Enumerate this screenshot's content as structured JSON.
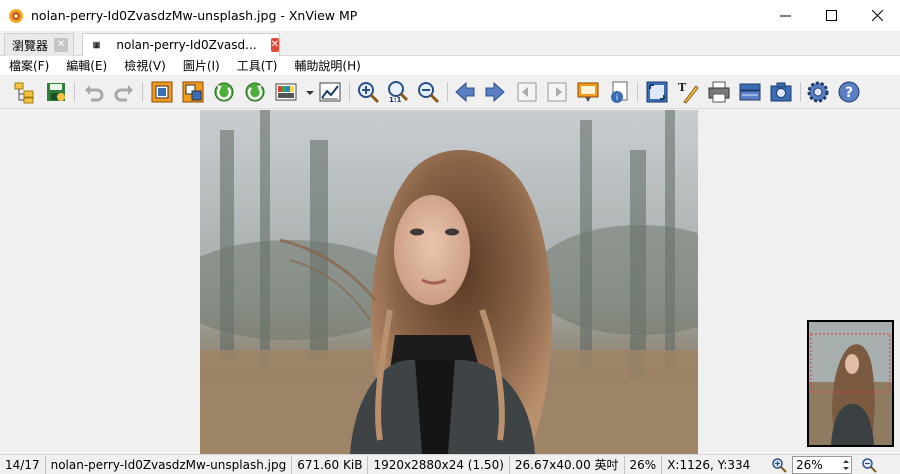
{
  "window": {
    "title": "nolan-perry-Id0ZvasdzMw-unsplash.jpg - XnView MP",
    "controls": {
      "minimize": "—",
      "maximize": "☐",
      "close": "✕"
    }
  },
  "tabs": [
    {
      "label": "瀏覽器",
      "close": "✕"
    },
    {
      "label": "nolan-perry-Id0Zvasd...",
      "close": "✕"
    }
  ],
  "menu": [
    {
      "label": "檔案(F)"
    },
    {
      "label": "編輯(E)"
    },
    {
      "label": "檢視(V)"
    },
    {
      "label": "圖片(I)"
    },
    {
      "label": "工具(T)"
    },
    {
      "label": "輔助說明(H)"
    }
  ],
  "toolbar": {
    "zoom_1to1_label": "1:1"
  },
  "status": {
    "index": "14/17",
    "filename": "nolan-perry-Id0ZvasdzMw-unsplash.jpg",
    "filesize": "671.60 KiB",
    "dimensions": "1920x2880x24 (1.50)",
    "print_size": "26.67x40.00 英吋",
    "zoom": "26%",
    "coords": "X:1126, Y:334",
    "zoom_field": "26%"
  },
  "colors": {
    "accent_orange": "#f5a623",
    "close_red": "#e04a3a",
    "toolbar_blue": "#3b6db5"
  }
}
